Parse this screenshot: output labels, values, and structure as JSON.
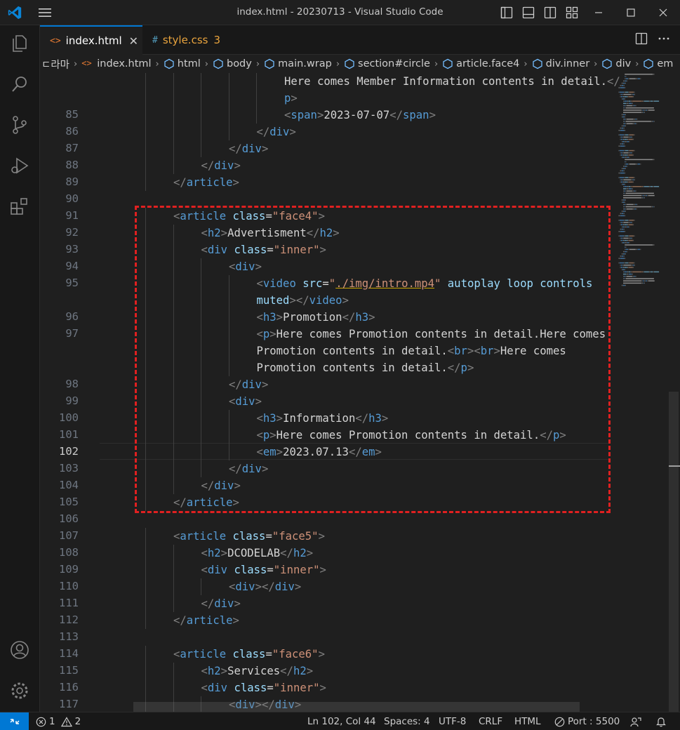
{
  "window": {
    "title": "index.html - 20230713 - Visual Studio Code"
  },
  "tabs": [
    {
      "label": "index.html",
      "icon": "html-file-icon",
      "active": true
    },
    {
      "label": "style.css",
      "icon": "css-file-icon",
      "badge": "3"
    }
  ],
  "breadcrumb": {
    "leading": "ㄷ라마",
    "items": [
      "index.html",
      "html",
      "body",
      "main.wrap",
      "section#circle",
      "article.face4",
      "div.inner",
      "div",
      "em"
    ]
  },
  "editor": {
    "current_line": "102",
    "lines": [
      {
        "n": "",
        "indent": 6,
        "tokens": [
          [
            "t-text",
            "Here comes Member Information contents in detail."
          ],
          [
            "t-punct",
            "</"
          ]
        ]
      },
      {
        "n": "",
        "indent": 6,
        "tokens": [
          [
            "t-tag",
            "p"
          ],
          [
            "t-punct",
            ">"
          ]
        ]
      },
      {
        "n": "85",
        "indent": 6,
        "tokens": [
          [
            "t-punct",
            "<"
          ],
          [
            "t-tag",
            "span"
          ],
          [
            "t-punct",
            ">"
          ],
          [
            "t-text",
            "2023-07-07"
          ],
          [
            "t-punct",
            "</"
          ],
          [
            "t-tag",
            "span"
          ],
          [
            "t-punct",
            ">"
          ]
        ]
      },
      {
        "n": "86",
        "indent": 5,
        "tokens": [
          [
            "t-punct",
            "</"
          ],
          [
            "t-tag",
            "div"
          ],
          [
            "t-punct",
            ">"
          ]
        ]
      },
      {
        "n": "87",
        "indent": 4,
        "tokens": [
          [
            "t-punct",
            "</"
          ],
          [
            "t-tag",
            "div"
          ],
          [
            "t-punct",
            ">"
          ]
        ]
      },
      {
        "n": "88",
        "indent": 3,
        "tokens": [
          [
            "t-punct",
            "</"
          ],
          [
            "t-tag",
            "div"
          ],
          [
            "t-punct",
            ">"
          ]
        ]
      },
      {
        "n": "89",
        "indent": 2,
        "tokens": [
          [
            "t-punct",
            "</"
          ],
          [
            "t-tag",
            "article"
          ],
          [
            "t-punct",
            ">"
          ]
        ]
      },
      {
        "n": "90",
        "indent": 0,
        "tokens": []
      },
      {
        "n": "91",
        "indent": 2,
        "tokens": [
          [
            "t-punct",
            "<"
          ],
          [
            "t-tag",
            "article"
          ],
          [
            "t-text",
            " "
          ],
          [
            "t-attr",
            "class"
          ],
          [
            "t-text",
            "="
          ],
          [
            "t-str",
            "\"face4\""
          ],
          [
            "t-punct",
            ">"
          ]
        ]
      },
      {
        "n": "92",
        "indent": 3,
        "tokens": [
          [
            "t-punct",
            "<"
          ],
          [
            "t-tag",
            "h2"
          ],
          [
            "t-punct",
            ">"
          ],
          [
            "t-text",
            "Advertisment"
          ],
          [
            "t-punct",
            "</"
          ],
          [
            "t-tag",
            "h2"
          ],
          [
            "t-punct",
            ">"
          ]
        ]
      },
      {
        "n": "93",
        "indent": 3,
        "tokens": [
          [
            "t-punct",
            "<"
          ],
          [
            "t-tag",
            "div"
          ],
          [
            "t-text",
            " "
          ],
          [
            "t-attr",
            "class"
          ],
          [
            "t-text",
            "="
          ],
          [
            "t-str",
            "\"inner\""
          ],
          [
            "t-punct",
            ">"
          ]
        ]
      },
      {
        "n": "94",
        "indent": 4,
        "tokens": [
          [
            "t-punct",
            "<"
          ],
          [
            "t-tag",
            "div"
          ],
          [
            "t-punct",
            ">"
          ]
        ]
      },
      {
        "n": "95",
        "indent": 5,
        "tokens": [
          [
            "t-punct",
            "<"
          ],
          [
            "t-tag",
            "video"
          ],
          [
            "t-text",
            " "
          ],
          [
            "t-attr",
            "src"
          ],
          [
            "t-text",
            "="
          ],
          [
            "t-str",
            "\""
          ],
          [
            "t-link",
            "./img/intro.mp4"
          ],
          [
            "t-str",
            "\""
          ],
          [
            "t-text",
            " "
          ],
          [
            "t-attr",
            "autoplay"
          ],
          [
            "t-text",
            " "
          ],
          [
            "t-attr",
            "loop"
          ],
          [
            "t-text",
            " "
          ],
          [
            "t-attr",
            "controls"
          ]
        ]
      },
      {
        "n": "",
        "indent": 5,
        "tokens": [
          [
            "t-attr",
            "muted"
          ],
          [
            "t-punct",
            "></"
          ],
          [
            "t-tag",
            "video"
          ],
          [
            "t-punct",
            ">"
          ]
        ]
      },
      {
        "n": "96",
        "indent": 5,
        "tokens": [
          [
            "t-punct",
            "<"
          ],
          [
            "t-tag",
            "h3"
          ],
          [
            "t-punct",
            ">"
          ],
          [
            "t-text",
            "Promotion"
          ],
          [
            "t-punct",
            "</"
          ],
          [
            "t-tag",
            "h3"
          ],
          [
            "t-punct",
            ">"
          ]
        ]
      },
      {
        "n": "97",
        "indent": 5,
        "tokens": [
          [
            "t-punct",
            "<"
          ],
          [
            "t-tag",
            "p"
          ],
          [
            "t-punct",
            ">"
          ],
          [
            "t-text",
            "Here comes Promotion contents in detail.Here comes"
          ]
        ]
      },
      {
        "n": "",
        "indent": 5,
        "tokens": [
          [
            "t-text",
            "Promotion contents in detail."
          ],
          [
            "t-punct",
            "<"
          ],
          [
            "t-tag",
            "br"
          ],
          [
            "t-punct",
            "><"
          ],
          [
            "t-tag",
            "br"
          ],
          [
            "t-punct",
            ">"
          ],
          [
            "t-text",
            "Here comes"
          ]
        ]
      },
      {
        "n": "",
        "indent": 5,
        "tokens": [
          [
            "t-text",
            "Promotion contents in detail."
          ],
          [
            "t-punct",
            "</"
          ],
          [
            "t-tag",
            "p"
          ],
          [
            "t-punct",
            ">"
          ]
        ]
      },
      {
        "n": "98",
        "indent": 4,
        "tokens": [
          [
            "t-punct",
            "</"
          ],
          [
            "t-tag",
            "div"
          ],
          [
            "t-punct",
            ">"
          ]
        ]
      },
      {
        "n": "99",
        "indent": 4,
        "tokens": [
          [
            "t-punct",
            "<"
          ],
          [
            "t-tag",
            "div"
          ],
          [
            "t-punct",
            ">"
          ]
        ]
      },
      {
        "n": "100",
        "indent": 5,
        "tokens": [
          [
            "t-punct",
            "<"
          ],
          [
            "t-tag",
            "h3"
          ],
          [
            "t-punct",
            ">"
          ],
          [
            "t-text",
            "Information"
          ],
          [
            "t-punct",
            "</"
          ],
          [
            "t-tag",
            "h3"
          ],
          [
            "t-punct",
            ">"
          ]
        ]
      },
      {
        "n": "101",
        "indent": 5,
        "tokens": [
          [
            "t-punct",
            "<"
          ],
          [
            "t-tag",
            "p"
          ],
          [
            "t-punct",
            ">"
          ],
          [
            "t-text",
            "Here comes Promotion contents in detail."
          ],
          [
            "t-punct",
            "</"
          ],
          [
            "t-tag",
            "p"
          ],
          [
            "t-punct",
            ">"
          ]
        ]
      },
      {
        "n": "102",
        "indent": 5,
        "tokens": [
          [
            "t-punct",
            "<"
          ],
          [
            "t-tag",
            "em"
          ],
          [
            "t-punct",
            ">"
          ],
          [
            "t-text",
            "2023.07.13"
          ],
          [
            "t-punct",
            "</"
          ],
          [
            "t-tag",
            "em"
          ],
          [
            "t-punct",
            ">"
          ]
        ]
      },
      {
        "n": "103",
        "indent": 4,
        "tokens": [
          [
            "t-punct",
            "</"
          ],
          [
            "t-tag",
            "div"
          ],
          [
            "t-punct",
            ">"
          ]
        ]
      },
      {
        "n": "104",
        "indent": 3,
        "tokens": [
          [
            "t-punct",
            "</"
          ],
          [
            "t-tag",
            "div"
          ],
          [
            "t-punct",
            ">"
          ]
        ]
      },
      {
        "n": "105",
        "indent": 2,
        "tokens": [
          [
            "t-punct",
            "</"
          ],
          [
            "t-tag",
            "article"
          ],
          [
            "t-punct",
            ">"
          ]
        ]
      },
      {
        "n": "106",
        "indent": 0,
        "tokens": []
      },
      {
        "n": "107",
        "indent": 2,
        "tokens": [
          [
            "t-punct",
            "<"
          ],
          [
            "t-tag",
            "article"
          ],
          [
            "t-text",
            " "
          ],
          [
            "t-attr",
            "class"
          ],
          [
            "t-text",
            "="
          ],
          [
            "t-str",
            "\"face5\""
          ],
          [
            "t-punct",
            ">"
          ]
        ]
      },
      {
        "n": "108",
        "indent": 3,
        "tokens": [
          [
            "t-punct",
            "<"
          ],
          [
            "t-tag",
            "h2"
          ],
          [
            "t-punct",
            ">"
          ],
          [
            "t-text",
            "DCODELAB"
          ],
          [
            "t-punct",
            "</"
          ],
          [
            "t-tag",
            "h2"
          ],
          [
            "t-punct",
            ">"
          ]
        ]
      },
      {
        "n": "109",
        "indent": 3,
        "tokens": [
          [
            "t-punct",
            "<"
          ],
          [
            "t-tag",
            "div"
          ],
          [
            "t-text",
            " "
          ],
          [
            "t-attr",
            "class"
          ],
          [
            "t-text",
            "="
          ],
          [
            "t-str",
            "\"inner\""
          ],
          [
            "t-punct",
            ">"
          ]
        ]
      },
      {
        "n": "110",
        "indent": 4,
        "tokens": [
          [
            "t-punct",
            "<"
          ],
          [
            "t-tag",
            "div"
          ],
          [
            "t-punct",
            "></"
          ],
          [
            "t-tag",
            "div"
          ],
          [
            "t-punct",
            ">"
          ]
        ]
      },
      {
        "n": "111",
        "indent": 3,
        "tokens": [
          [
            "t-punct",
            "</"
          ],
          [
            "t-tag",
            "div"
          ],
          [
            "t-punct",
            ">"
          ]
        ]
      },
      {
        "n": "112",
        "indent": 2,
        "tokens": [
          [
            "t-punct",
            "</"
          ],
          [
            "t-tag",
            "article"
          ],
          [
            "t-punct",
            ">"
          ]
        ]
      },
      {
        "n": "113",
        "indent": 0,
        "tokens": []
      },
      {
        "n": "114",
        "indent": 2,
        "tokens": [
          [
            "t-punct",
            "<"
          ],
          [
            "t-tag",
            "article"
          ],
          [
            "t-text",
            " "
          ],
          [
            "t-attr",
            "class"
          ],
          [
            "t-text",
            "="
          ],
          [
            "t-str",
            "\"face6\""
          ],
          [
            "t-punct",
            ">"
          ]
        ]
      },
      {
        "n": "115",
        "indent": 3,
        "tokens": [
          [
            "t-punct",
            "<"
          ],
          [
            "t-tag",
            "h2"
          ],
          [
            "t-punct",
            ">"
          ],
          [
            "t-text",
            "Services"
          ],
          [
            "t-punct",
            "</"
          ],
          [
            "t-tag",
            "h2"
          ],
          [
            "t-punct",
            ">"
          ]
        ]
      },
      {
        "n": "116",
        "indent": 3,
        "tokens": [
          [
            "t-punct",
            "<"
          ],
          [
            "t-tag",
            "div"
          ],
          [
            "t-text",
            " "
          ],
          [
            "t-attr",
            "class"
          ],
          [
            "t-text",
            "="
          ],
          [
            "t-str",
            "\"inner\""
          ],
          [
            "t-punct",
            ">"
          ]
        ]
      },
      {
        "n": "117",
        "indent": 4,
        "tokens": [
          [
            "t-punct",
            "<"
          ],
          [
            "t-tag",
            "div"
          ],
          [
            "t-punct",
            "></"
          ],
          [
            "t-tag",
            "div"
          ],
          [
            "t-punct",
            ">"
          ]
        ]
      }
    ]
  },
  "status": {
    "errors": "1",
    "warnings": "2",
    "position": "Ln 102, Col 44",
    "spaces": "Spaces: 4",
    "encoding": "UTF-8",
    "eol": "CRLF",
    "language": "HTML",
    "port": "Port : 5500"
  },
  "colors": {
    "accent": "#0078d4",
    "highlight_box": "#e02020",
    "tag": "#569cd6",
    "attribute": "#9cdcfe",
    "string": "#ce9178"
  }
}
